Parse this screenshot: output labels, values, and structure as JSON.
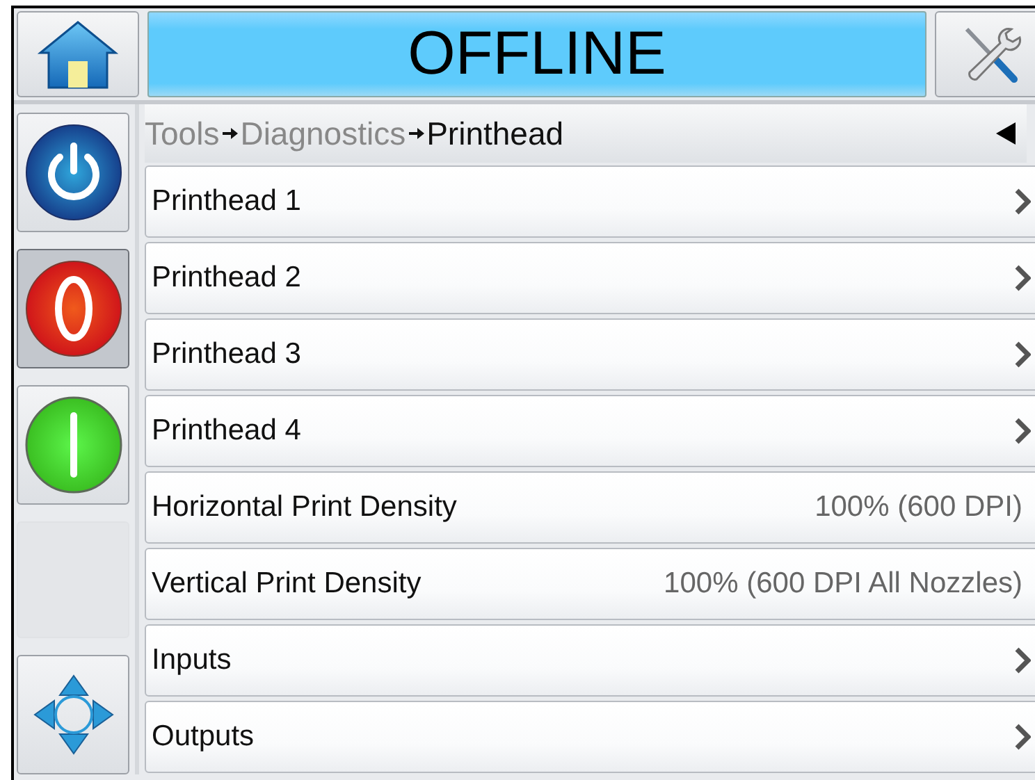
{
  "header": {
    "status": "OFFLINE"
  },
  "side_buttons": [
    {
      "kind": "power",
      "selected": false
    },
    {
      "kind": "stop",
      "selected": true
    },
    {
      "kind": "start",
      "selected": false
    },
    {
      "kind": "empty",
      "selected": false
    },
    {
      "kind": "navigate",
      "selected": false
    }
  ],
  "breadcrumb": [
    {
      "label": "Tools",
      "current": false
    },
    {
      "label": "Diagnostics",
      "current": false
    },
    {
      "label": "Printhead",
      "current": true
    }
  ],
  "rows": [
    {
      "kind": "nav",
      "label": "Printhead 1"
    },
    {
      "kind": "nav",
      "label": "Printhead 2"
    },
    {
      "kind": "nav",
      "label": "Printhead 3"
    },
    {
      "kind": "nav",
      "label": "Printhead 4"
    },
    {
      "kind": "value",
      "label": "Horizontal Print Density",
      "value": "100% (600 DPI)"
    },
    {
      "kind": "value",
      "label": "Vertical Print Density",
      "value": "100% (600 DPI All Nozzles)"
    },
    {
      "kind": "nav",
      "label": "Inputs"
    },
    {
      "kind": "nav",
      "label": "Outputs"
    }
  ]
}
